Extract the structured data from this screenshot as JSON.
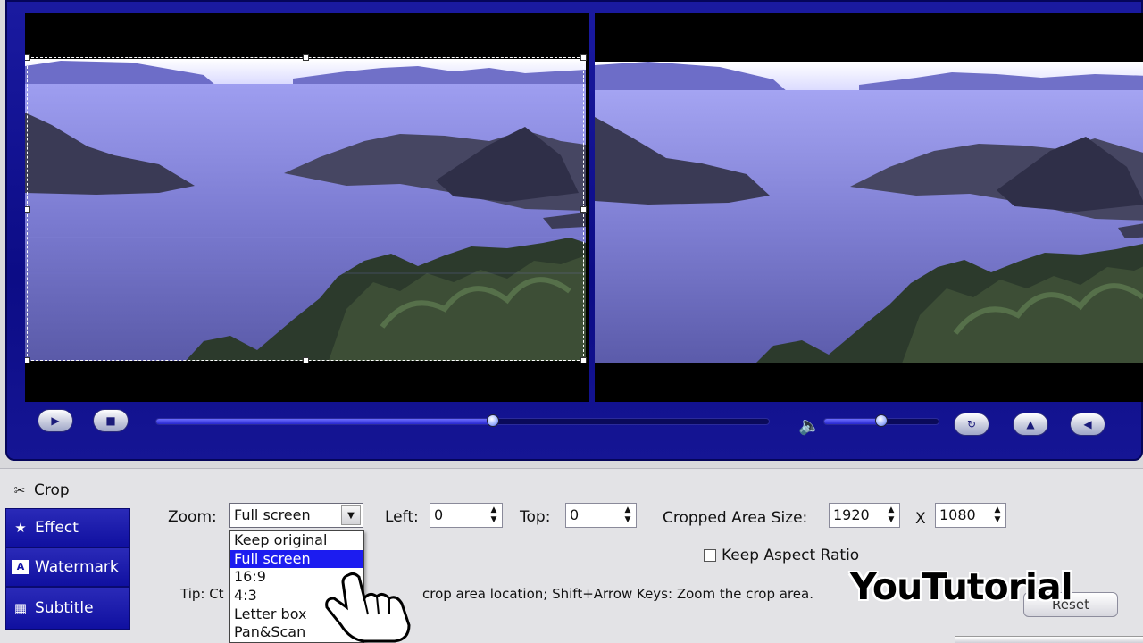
{
  "preview": {
    "scene_description_alt": ""
  },
  "controls": {
    "play_icon": "play-icon",
    "stop_icon": "stop-icon",
    "progress_fraction": 0.55,
    "volume_fraction": 0.5,
    "volume_icon": "speaker-icon",
    "rotate_icon": "rotate-icon",
    "flip_horizontal_icon": "flip-horizontal-icon",
    "flip_vertical_icon": "flip-vertical-icon"
  },
  "tabs": [
    {
      "label": "Crop",
      "icon": "scissors-icon",
      "active": true
    },
    {
      "label": "Effect",
      "icon": "star-icon",
      "active": false
    },
    {
      "label": "Watermark",
      "icon": "watermark-icon",
      "active": false
    },
    {
      "label": "Subtitle",
      "icon": "subtitle-icon",
      "active": false
    }
  ],
  "crop": {
    "zoom_label": "Zoom:",
    "zoom_value": "Full screen",
    "zoom_options": [
      "Keep original",
      "Full screen",
      "16:9",
      "4:3",
      "Letter box",
      "Pan&Scan"
    ],
    "zoom_selected_index": 1,
    "left_label": "Left:",
    "left_value": "0",
    "top_label": "Top:",
    "top_value": "0",
    "cropped_area_label": "Cropped Area Size:",
    "width_value": "1920",
    "x_sep": "X",
    "height_value": "1080",
    "keep_aspect_label": "Keep Aspect Ratio",
    "keep_aspect_checked": false,
    "tip_prefix": "Tip: Ct",
    "tip_suffix": "crop area location; Shift+Arrow Keys: Zoom the crop area.",
    "reset_label": "Reset"
  },
  "watermark_text": "YouTutorial",
  "colors": {
    "accent": "#1414a8",
    "selection": "#1c1cf0",
    "panel": "#e3e3e6"
  }
}
